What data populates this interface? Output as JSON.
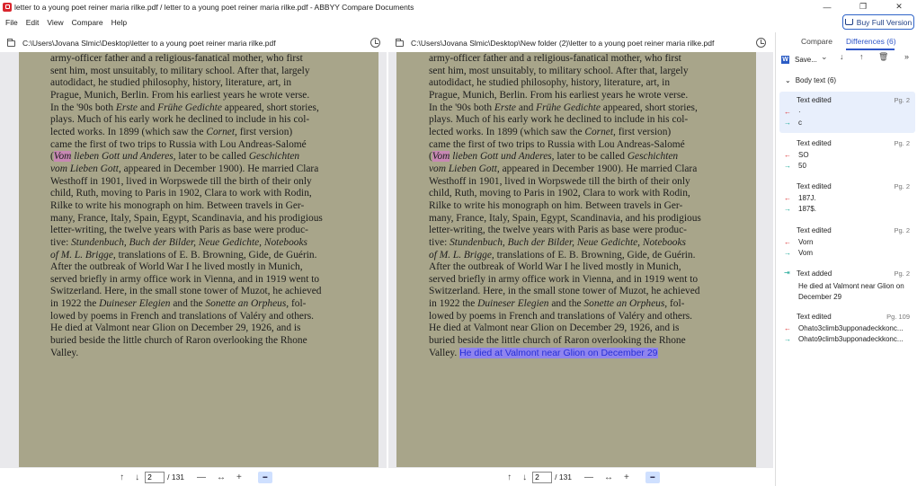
{
  "window": {
    "title": "letter to a young poet reiner maria rilke.pdf / letter to a young poet reiner maria rilke.pdf - ABBYY Compare Documents",
    "buttons": {
      "minimize": "—",
      "maximize": "❐",
      "close": "✕"
    }
  },
  "menu": [
    "File",
    "Edit",
    "View",
    "Compare",
    "Help"
  ],
  "buy_button": "Buy Full Version",
  "left_doc": {
    "path": "C:\\Users\\Jovana Slmic\\Desktop\\letter to a young poet reiner maria rilke.pdf",
    "page": "2",
    "total": "/ 131"
  },
  "right_doc": {
    "path": "C:\\Users\\Jovana Slmic\\Desktop\\New folder (2)\\letter to a young poet reiner maria rilke.pdf",
    "page": "2",
    "total": "/ 131",
    "added_text": "He died at Valmont near Glion on December 29"
  },
  "doc_text": {
    "l1": "army-officer father and a religious-fanatical mother, who first",
    "l2": "sent him, most unsuitably, to military school. After that, largely",
    "l3": "autodidact, he studied philosophy, history, literature, art, in",
    "l4": "Prague, Munich, Berlin. From his earliest years he wrote verse.",
    "l5a": "In the '90s both ",
    "l5b": "Erste",
    "l5c": " and ",
    "l5d": "Frühe Gedichte",
    "l5e": " appeared, short stories,",
    "l6": "plays. Much of his early work he declined to include in his col-",
    "l7a": "lected works. In 1899 (which saw the ",
    "l7b": "Cornet,",
    "l7c": " first version)",
    "l8": "came the first of two trips to Russia with Lou Andreas-Salomé",
    "l9a": "(",
    "l9b": "Vom",
    "l9c": " lieben Gott und Anderes,",
    "l9d": " later to be called ",
    "l9e": "Geschichten",
    "l10a": "vom Lieben Gott,",
    "l10b": " appeared in December 1900). He married Clara",
    "l11": "Westhoff in 1901, lived in Worpswede till the birth of their only",
    "l12": "child, Ruth, moving to Paris in 1902, Clara to work with Rodin,",
    "l13": "Rilke to write his monograph on him. Between travels in Ger-",
    "l14": "many, France, Italy, Spain, Egypt, Scandinavia, and his prodigious",
    "l15": "letter-writing, the twelve years with Paris as base were produc-",
    "l16a": "tive: ",
    "l16b": "Stundenbuch, Buch der Bilder, Neue Gedichte, Notebooks",
    "l17a": "of M. L. Brigge,",
    "l17b": " translations of E. B. Browning, Gide, de Guérin.",
    "l18": "After the outbreak of World War I he lived mostly in Munich,",
    "l19": "served briefly in army office work in Vienna, and in 1919 went to",
    "l20": "Switzerland. Here, in the small stone tower of Muzot, he achieved",
    "l21a": "in 1922 the ",
    "l21b": "Duineser Elegien",
    "l21c": " and the ",
    "l21d": "Sonette an Orpheus,",
    "l21e": " fol-",
    "l22": "lowed by poems in French and translations of Valéry and others.",
    "l23": "He died at Valmont near Glion on December 29, 1926, and is",
    "l24": "buried beside the little church of Raron overlooking the Rhone",
    "l25": "Valley."
  },
  "side": {
    "tab_compare": "Compare",
    "tab_differences": "Differences (6)",
    "save_label": "Save...",
    "group_label": "Body text (6)",
    "diffs": [
      {
        "kind": "Text edited",
        "page": "Pg. 2",
        "old": "·",
        "new": "c"
      },
      {
        "kind": "Text edited",
        "page": "Pg. 2",
        "old": "SO",
        "new": "50"
      },
      {
        "kind": "Text edited",
        "page": "Pg. 2",
        "old": "187J.",
        "new": "187$."
      },
      {
        "kind": "Text edited",
        "page": "Pg. 2",
        "old": "Vorn",
        "new": "Vom"
      },
      {
        "kind": "Text added",
        "page": "Pg. 2",
        "text": "He died at Valmont near Glion on December 29"
      },
      {
        "kind": "Text edited",
        "page": "Pg. 109",
        "old": "Ohato3climb3upponadeckkonc...",
        "new": "Ohato9climb3upponadeckkonc..."
      }
    ]
  }
}
